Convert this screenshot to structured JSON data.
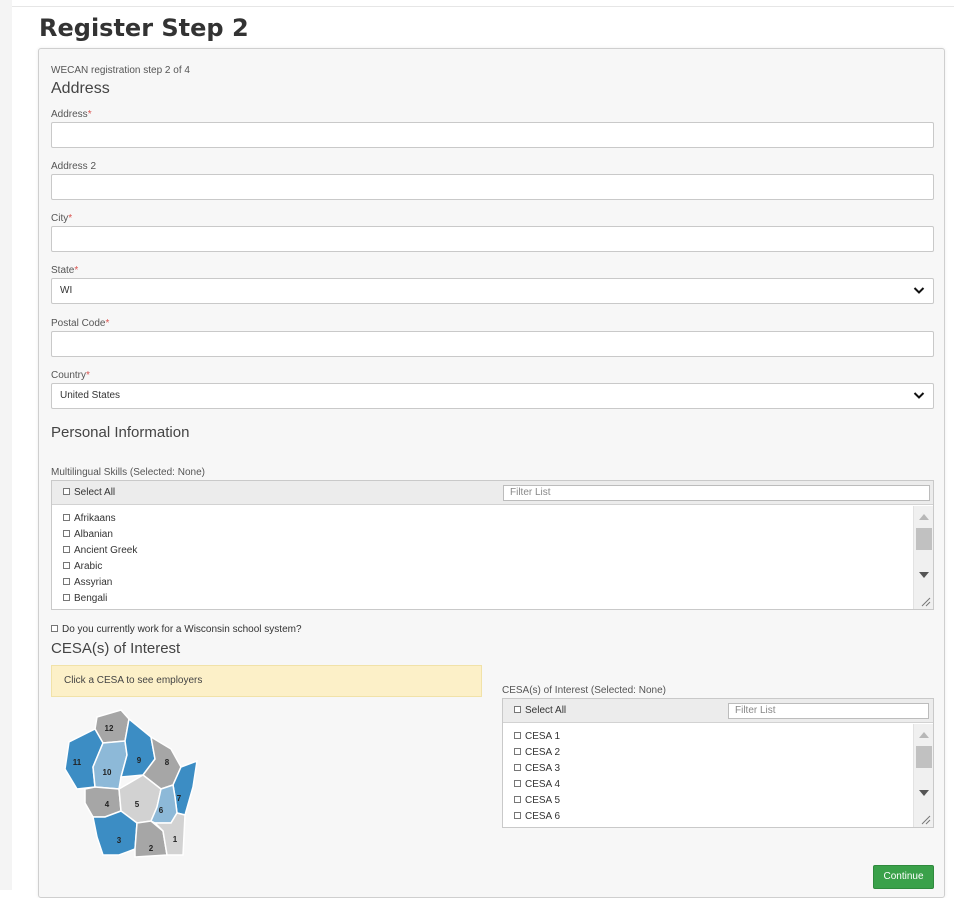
{
  "page": {
    "title": "Register Step 2"
  },
  "form": {
    "step_text": "WECAN registration step 2 of 4",
    "address_section": "Address",
    "address": {
      "label": "Address",
      "required": "*",
      "value": ""
    },
    "address2": {
      "label": "Address 2",
      "value": ""
    },
    "city": {
      "label": "City",
      "required": "*",
      "value": ""
    },
    "state": {
      "label": "State",
      "required": "*",
      "value": "WI"
    },
    "postal": {
      "label": "Postal Code",
      "required": "*",
      "value": ""
    },
    "country": {
      "label": "Country",
      "required": "*",
      "value": "United States"
    },
    "personal_section": "Personal Information",
    "languages": {
      "label": "Multilingual Skills (Selected: None)",
      "select_all": "Select All",
      "filter_placeholder": "Filter List",
      "items": [
        "Afrikaans",
        "Albanian",
        "Ancient Greek",
        "Arabic",
        "Assyrian",
        "Bengali"
      ]
    },
    "wisconsin_question": "Do you currently work for a Wisconsin school system?",
    "cesa_section": "CESA(s) of Interest",
    "cesa_notice": "Click a CESA to see employers",
    "cesa": {
      "label": "CESA(s) of Interest (Selected: None)",
      "select_all": "Select All",
      "filter_placeholder": "Filter List",
      "items": [
        "CESA 1",
        "CESA 2",
        "CESA 3",
        "CESA 4",
        "CESA 5",
        "CESA 6"
      ]
    },
    "map_labels": [
      "12",
      "11",
      "10",
      "9",
      "8",
      "7",
      "4",
      "5",
      "6",
      "3",
      "2",
      "1"
    ],
    "continue_label": "Continue"
  },
  "colors": {
    "dark_blue": "#3c8dc4",
    "light_blue": "#8db9d8",
    "gray": "#a6a6a6",
    "light_gray": "#d2d2d2",
    "button_green": "#3aa14a",
    "required_red": "#d9534f"
  }
}
